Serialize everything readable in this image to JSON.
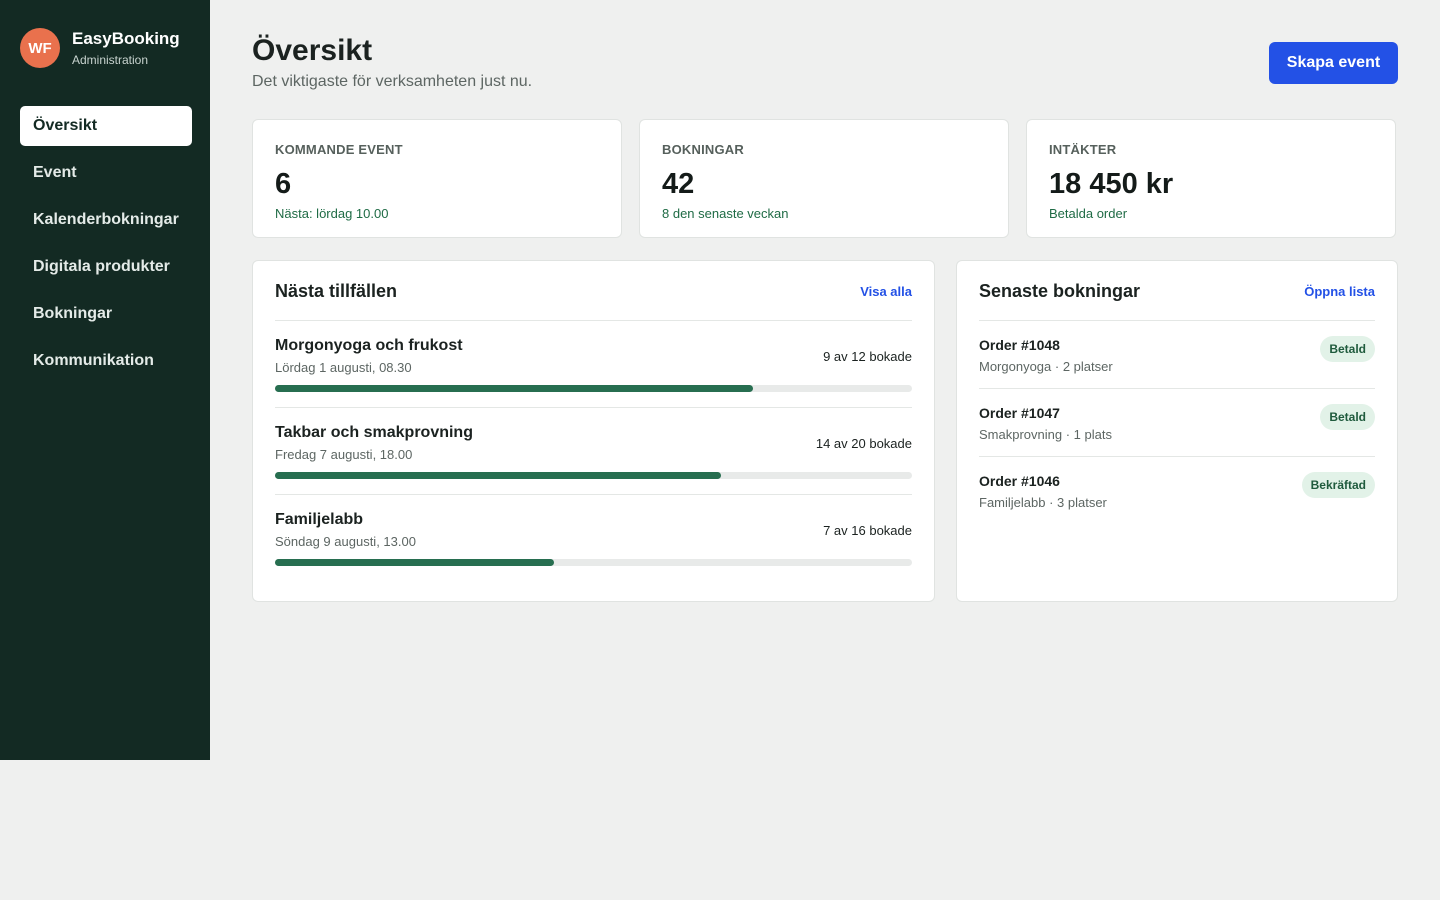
{
  "brand": {
    "initials": "WF",
    "name": "EasyBooking",
    "subtitle": "Administration"
  },
  "nav": [
    {
      "label": "Översikt",
      "active": true
    },
    {
      "label": "Event"
    },
    {
      "label": "Kalenderbokningar"
    },
    {
      "label": "Digitala produkter"
    },
    {
      "label": "Bokningar"
    },
    {
      "label": "Kommunikation"
    }
  ],
  "header": {
    "title": "Översikt",
    "subtitle": "Det viktigaste för verksamheten just nu.",
    "primary_action": "Skapa event"
  },
  "stats": [
    {
      "label": "KOMMANDE EVENT",
      "value": "6",
      "note": "Nästa: lördag 10.00"
    },
    {
      "label": "BOKNINGAR",
      "value": "42",
      "note": "8 den senaste veckan"
    },
    {
      "label": "INTÄKTER",
      "value": "18 450 kr",
      "note": "Betalda order"
    }
  ],
  "upcoming": {
    "title": "Nästa tillfällen",
    "link": "Visa alla",
    "events": [
      {
        "name": "Morgonyoga och frukost",
        "date": "Lördag 1 augusti, 08.30",
        "count": "9 av 12 bokade",
        "booked": 9,
        "capacity": 12
      },
      {
        "name": "Takbar och smakprovning",
        "date": "Fredag 7 augusti, 18.00",
        "count": "14 av 20 bokade",
        "booked": 14,
        "capacity": 20
      },
      {
        "name": "Familjelabb",
        "date": "Söndag 9 augusti, 13.00",
        "count": "7 av 16 bokade",
        "booked": 7,
        "capacity": 16
      }
    ]
  },
  "recent": {
    "title": "Senaste bokningar",
    "link": "Öppna lista",
    "orders": [
      {
        "id": "Order #1048",
        "detail": "Morgonyoga · 2 platser",
        "status": "Betald"
      },
      {
        "id": "Order #1047",
        "detail": "Smakprovning · 1 plats",
        "status": "Betald"
      },
      {
        "id": "Order #1046",
        "detail": "Familjelabb · 3 platser",
        "status": "Bekräftad"
      }
    ]
  },
  "colors": {
    "sidebar": "#132a23",
    "accent": "#2351e6",
    "progress": "#276e50",
    "avatar": "#e9714d",
    "badge_bg": "#e2f2e8"
  }
}
